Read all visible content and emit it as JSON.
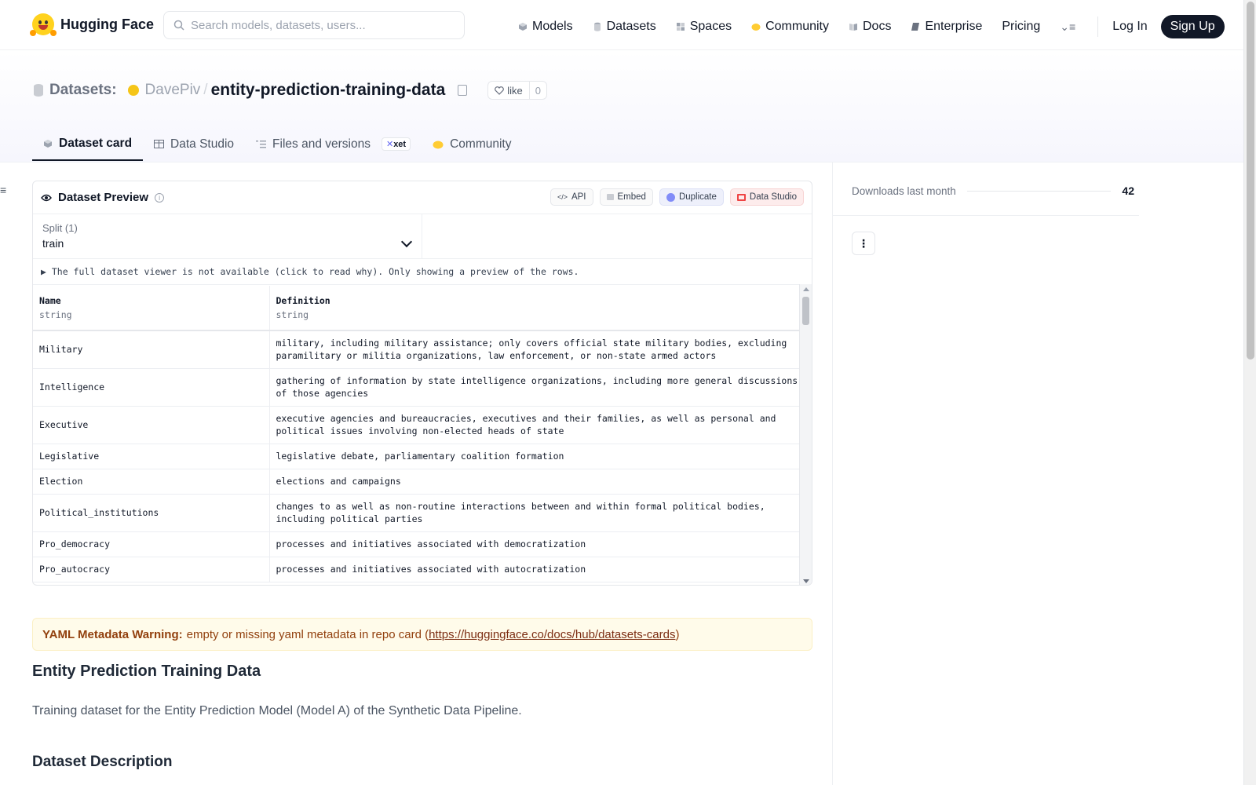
{
  "brand": {
    "name": "Hugging Face",
    "accent": "#ffd21e"
  },
  "search": {
    "placeholder": "Search models, datasets, users..."
  },
  "nav": {
    "links": [
      "Models",
      "Datasets",
      "Spaces",
      "Community",
      "Docs",
      "Enterprise",
      "Pricing"
    ],
    "login": "Log In",
    "signup": "Sign Up"
  },
  "repo": {
    "type_label": "Datasets:",
    "owner": "DavePiv",
    "separator": "/",
    "name": "entity-prediction-training-data",
    "like_label": "like",
    "like_count": "0"
  },
  "tabs": {
    "dataset_card": "Dataset card",
    "data_studio": "Data Studio",
    "files": "Files and versions",
    "xet_badge": "xet",
    "community": "Community"
  },
  "preview": {
    "title": "Dataset Preview",
    "buttons": {
      "api": "API",
      "embed": "Embed",
      "duplicate": "Duplicate",
      "data_studio": "Data Studio"
    },
    "split_label": "Split (1)",
    "split_value": "train",
    "notice": "▶ The full dataset viewer is not available (click to read why). Only showing a preview of the rows.",
    "columns": [
      {
        "name": "Name",
        "type": "string"
      },
      {
        "name": "Definition",
        "type": "string"
      }
    ],
    "rows": [
      {
        "name": "Military",
        "definition": "military, including military assistance; only covers official state military bodies, excluding paramilitary or militia organizations, law enforcement, or non-state armed actors"
      },
      {
        "name": "Intelligence",
        "definition": "gathering of information by state intelligence organizations, including more general discussions of those agencies"
      },
      {
        "name": "Executive",
        "definition": "executive agencies and bureaucracies, executives and their families, as well as personal and political issues involving non-elected heads of state"
      },
      {
        "name": "Legislative",
        "definition": "legislative debate, parliamentary coalition formation"
      },
      {
        "name": "Election",
        "definition": "elections and campaigns"
      },
      {
        "name": "Political_institutions",
        "definition": "changes to as well as non-routine interactions between and within formal political bodies, including political parties"
      },
      {
        "name": "Pro_democracy",
        "definition": "processes and initiatives associated with democratization"
      },
      {
        "name": "Pro_autocracy",
        "definition": "processes and initiatives associated with autocratization"
      }
    ]
  },
  "warning": {
    "label": "YAML Metadata Warning:",
    "text": "empty or missing yaml metadata in repo card (",
    "link": "https://huggingface.co/docs/hub/datasets-cards",
    "close": ")"
  },
  "card": {
    "heading": "Entity Prediction Training Data",
    "intro": "Training dataset for the Entity Prediction Model (Model A) of the Synthetic Data Pipeline.",
    "section": "Dataset Description"
  },
  "sidebar": {
    "downloads_label": "Downloads last month",
    "downloads_value": "42"
  }
}
